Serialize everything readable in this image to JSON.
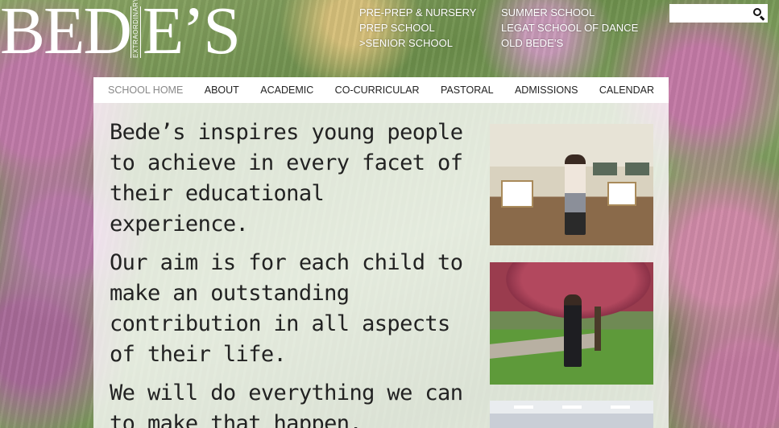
{
  "logo": {
    "word_part1": "BED",
    "word_part2": "E’S",
    "tagline": "EXTRAORDINARY"
  },
  "top_links": {
    "column1": [
      {
        "label": "PRE-PREP & NURSERY",
        "prefix": ""
      },
      {
        "label": "PREP SCHOOL",
        "prefix": ""
      },
      {
        "label": "SENIOR SCHOOL",
        "prefix": ">"
      }
    ],
    "column2": [
      {
        "label": "SUMMER SCHOOL",
        "prefix": ""
      },
      {
        "label": "LEGAT SCHOOL OF DANCE",
        "prefix": ""
      },
      {
        "label": "OLD BEDE’S",
        "prefix": ""
      }
    ]
  },
  "search": {
    "placeholder": "",
    "value": "",
    "icon": "search-icon"
  },
  "nav": {
    "items": [
      {
        "label": "SCHOOL HOME",
        "current": true
      },
      {
        "label": "ABOUT",
        "current": false
      },
      {
        "label": "ACADEMIC",
        "current": false
      },
      {
        "label": "CO-CURRICULAR",
        "current": false
      },
      {
        "label": "PASTORAL",
        "current": false
      },
      {
        "label": "ADMISSIONS",
        "current": false
      },
      {
        "label": "CALENDAR",
        "current": false
      }
    ]
  },
  "main": {
    "paragraphs": [
      "Bede’s inspires young people to achieve in every facet of their educational experience.",
      "Our aim is for each child to make an outstanding contribution in all aspects of their life.",
      "We will do everything we can to make that happen."
    ]
  },
  "colors": {
    "nav_bg": "#ffffff",
    "nav_current": "#888888",
    "text": "#222222",
    "overlay": "rgba(255,255,255,0.78)"
  }
}
